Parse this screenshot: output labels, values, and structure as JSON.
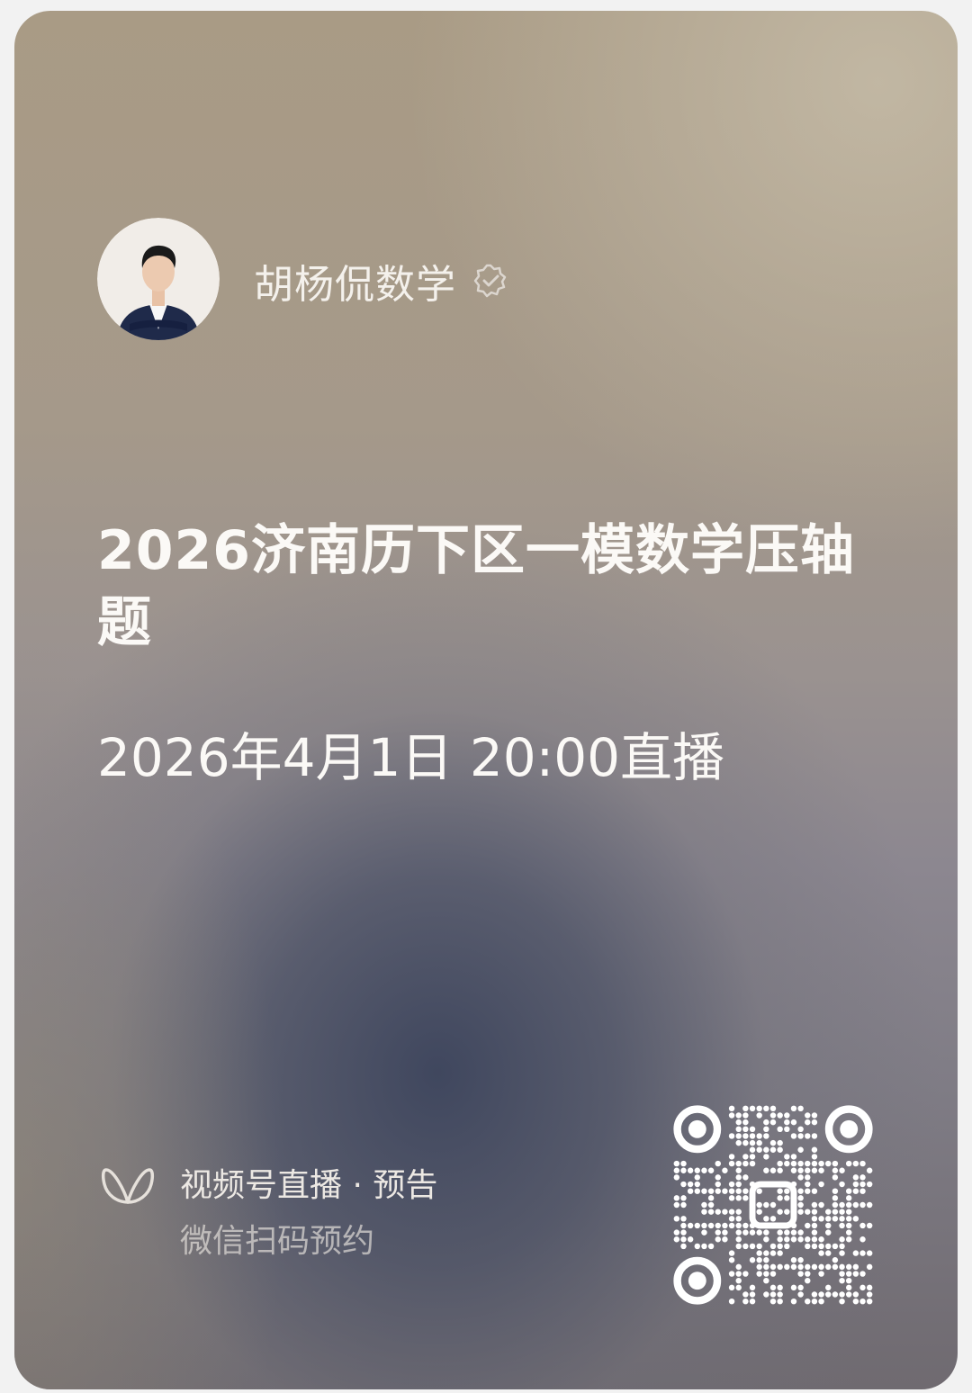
{
  "card": {
    "author_name": "胡杨侃数学",
    "verified_icon": "verified-badge-icon",
    "title": "2026济南历下区一模数学压轴题",
    "time": "2026年4月1日  20:00直播",
    "brand_icon": "channels-butterfly-icon",
    "brand_label": "视频号直播 · 预告",
    "brand_sub": "微信扫码预约",
    "qr_icon": "qr-code-icon"
  },
  "colors": {
    "text_primary": "#fbf9f6",
    "text_secondary": "#ece8e3"
  }
}
